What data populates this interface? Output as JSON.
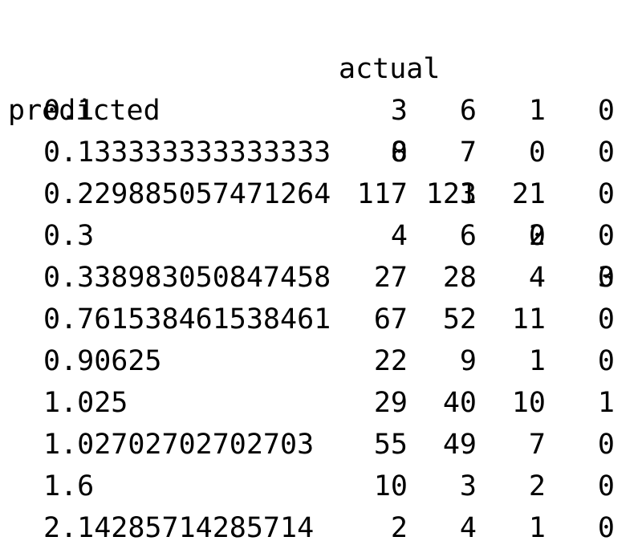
{
  "header": {
    "actual_label": "actual",
    "predicted_label": "predicted",
    "columns": [
      "0",
      "1",
      "2",
      "3"
    ]
  },
  "rows": [
    {
      "label": "0.1",
      "values": [
        "3",
        "6",
        "1",
        "0"
      ]
    },
    {
      "label": "0.133333333333333",
      "values": [
        "8",
        "7",
        "0",
        "0"
      ]
    },
    {
      "label": "0.229885057471264",
      "values": [
        "117",
        "123",
        "21",
        "0"
      ]
    },
    {
      "label": "0.3",
      "values": [
        "4",
        "6",
        "0",
        "0"
      ]
    },
    {
      "label": "0.338983050847458",
      "values": [
        "27",
        "28",
        "4",
        "0"
      ]
    },
    {
      "label": "0.761538461538461",
      "values": [
        "67",
        "52",
        "11",
        "0"
      ]
    },
    {
      "label": "0.90625",
      "values": [
        "22",
        "9",
        "1",
        "0"
      ]
    },
    {
      "label": "1.025",
      "values": [
        "29",
        "40",
        "10",
        "1"
      ]
    },
    {
      "label": "1.02702702702703",
      "values": [
        "55",
        "49",
        "7",
        "0"
      ]
    },
    {
      "label": "1.6",
      "values": [
        "10",
        "3",
        "2",
        "0"
      ]
    },
    {
      "label": "2.14285714285714",
      "values": [
        "2",
        "4",
        "1",
        "0"
      ]
    }
  ]
}
